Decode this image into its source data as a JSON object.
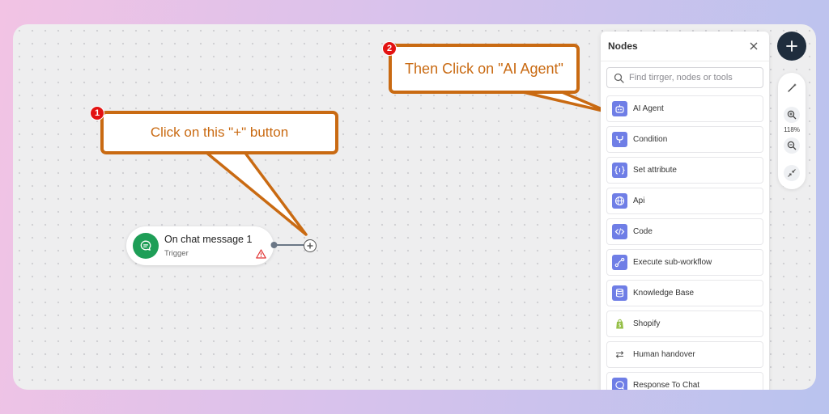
{
  "canvas": {
    "trigger_node": {
      "title": "On chat message 1",
      "subtitle": "Trigger",
      "icon": "chat-bubble-icon",
      "color": "#1e9e57"
    },
    "connector_add_icon": "plus-circle-icon"
  },
  "callouts": [
    {
      "number": "1",
      "text": "Click on this \"+\" button"
    },
    {
      "number": "2",
      "text": "Then Click on \"AI Agent\""
    }
  ],
  "colors": {
    "callout": "#c96a12",
    "badge": "#e31212",
    "accent": "#6f7ee6",
    "fab": "#1f2d3d"
  },
  "nodes_panel": {
    "title": "Nodes",
    "search_placeholder": "Find tirrger, nodes or tools",
    "items": [
      {
        "label": "AI Agent",
        "icon": "robot-icon"
      },
      {
        "label": "Condition",
        "icon": "branch-icon"
      },
      {
        "label": "Set attribute",
        "icon": "variable-icon"
      },
      {
        "label": "Api",
        "icon": "globe-icon"
      },
      {
        "label": "Code",
        "icon": "code-icon"
      },
      {
        "label": "Execute sub-workflow",
        "icon": "workflow-icon"
      },
      {
        "label": "Knowledge Base",
        "icon": "database-icon"
      },
      {
        "label": "Shopify",
        "icon": "shopify-icon"
      },
      {
        "label": "Human handover",
        "icon": "swap-arrows-icon"
      },
      {
        "label": "Response To Chat",
        "icon": "chat-reply-icon"
      }
    ]
  },
  "toolbar": {
    "zoom_level": "118%"
  }
}
